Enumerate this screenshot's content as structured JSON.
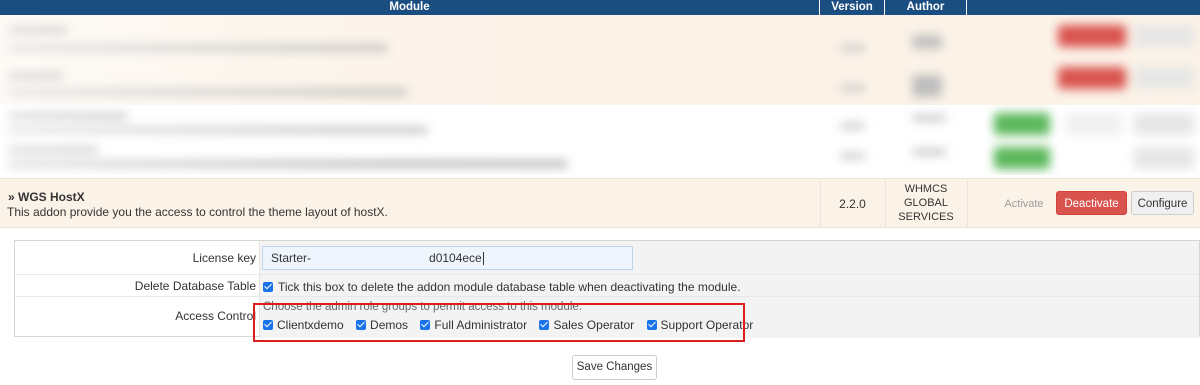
{
  "table_header": {
    "module": "Module",
    "version": "Version",
    "author": "Author"
  },
  "module_row": {
    "name": "» WGS HostX",
    "description": "This addon provide you the access to control the theme layout of hostX.",
    "version": "2.2.0",
    "author_lines": [
      "WHMCS",
      "GLOBAL",
      "SERVICES"
    ],
    "activate_label": "Activate",
    "deactivate_label": "Deactivate",
    "configure_label": "Configure"
  },
  "config": {
    "license_label": "License key",
    "license_value_start": "Starter-",
    "license_value_end": "d0104ece",
    "delete_db_label": "Delete Database Table",
    "delete_db_text": "Tick this box to delete the addon module database table when deactivating the module.",
    "delete_db_checked": true,
    "access_label": "Access Control",
    "access_caption": "Choose the admin role groups to permit access to this module:",
    "access_groups": [
      {
        "label": "Clientxdemo",
        "checked": true
      },
      {
        "label": "Demos",
        "checked": true
      },
      {
        "label": "Full Administrator",
        "checked": true
      },
      {
        "label": "Sales Operator",
        "checked": true
      },
      {
        "label": "Support Operator",
        "checked": true
      }
    ]
  },
  "save_label": "Save Changes",
  "colors": {
    "header_bg": "#1a4d80",
    "row_bg": "#fcf3e8",
    "deactivate_bg": "#d9534f",
    "highlight": "#d81e1e",
    "checkbox": "#1a73e8"
  }
}
